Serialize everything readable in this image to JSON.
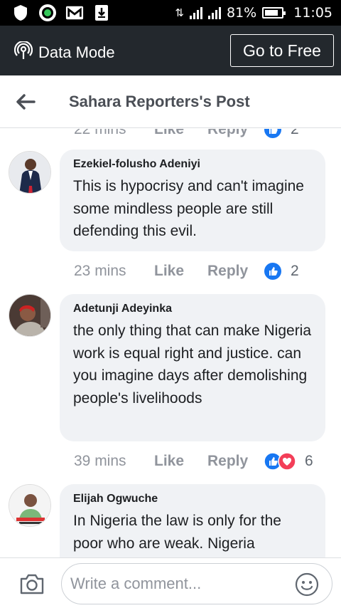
{
  "status_bar": {
    "battery": "81%",
    "time": "11:05"
  },
  "data_bar": {
    "label": "Data Mode",
    "go_free": "Go to Free"
  },
  "header": {
    "title": "Sahara Reporters's Post"
  },
  "partial_comment": {
    "time": "22 mins",
    "like": "Like",
    "reply": "Reply",
    "count": "2"
  },
  "comments": [
    {
      "author": "Ezekiel-folusho Adeniyi",
      "text": "This is hypocrisy and can't imagine some mindless people are still defending this evil.",
      "time": "23 mins",
      "like": "Like",
      "reply": "Reply",
      "reactions": [
        "like"
      ],
      "count": "2"
    },
    {
      "author": "Adetunji Adeyinka",
      "text": "the only thing that can make Nigeria work is equal right and justice. can you imagine days after demolishing people's livelihoods",
      "time": "39 mins",
      "like": "Like",
      "reply": "Reply",
      "reactions": [
        "like",
        "love"
      ],
      "count": "6"
    },
    {
      "author": "Elijah Ogwuche",
      "text": "In Nigeria the law is only for the poor who are weak. Nigeria"
    }
  ],
  "composer": {
    "placeholder": "Write a comment..."
  },
  "colors": {
    "like_blue": "#1877f2",
    "love_red": "#f33e58",
    "bubble": "#f0f2f5",
    "databar": "#23282d"
  }
}
